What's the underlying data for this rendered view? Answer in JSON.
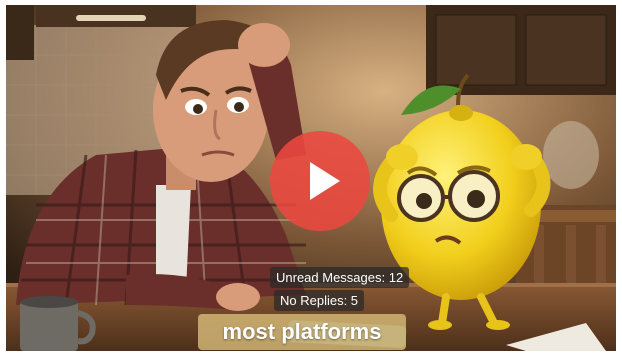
{
  "video": {
    "play_icon": "play-icon"
  },
  "overlays": {
    "unread_messages": "Unread Messages: 12",
    "no_replies": "No Replies: 5"
  },
  "caption": {
    "text": "most platforms"
  },
  "colors": {
    "play_button": "#ec4840",
    "caption_bg": "#d6ba78"
  }
}
